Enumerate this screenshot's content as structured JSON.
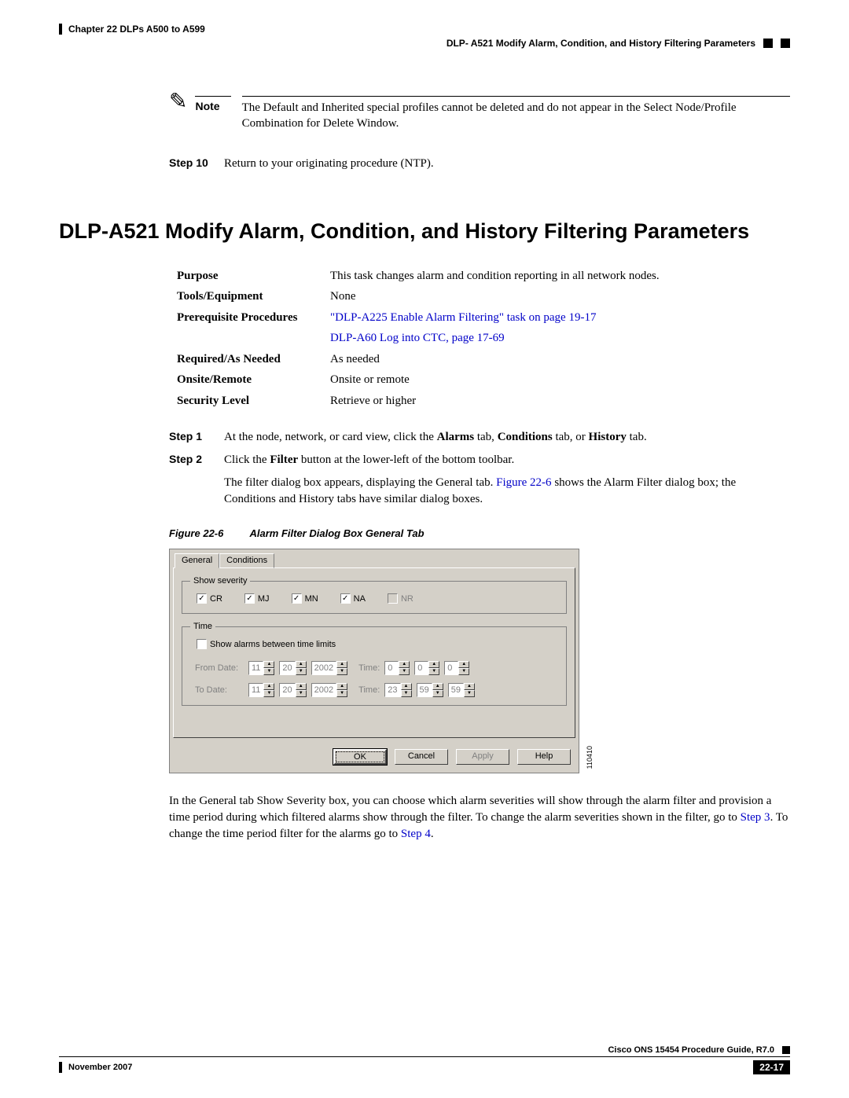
{
  "header": {
    "chapter": "Chapter 22      DLPs A500 to A599",
    "subtitle": "DLP- A521 Modify Alarm, Condition, and History Filtering Parameters"
  },
  "note": {
    "label": "Note",
    "text": "The Default and Inherited special profiles cannot be deleted and do not appear in the Select Node/Profile Combination for Delete Window."
  },
  "step10": {
    "label": "Step 10",
    "text": "Return to your originating procedure (NTP)."
  },
  "section_title": "DLP-A521 Modify Alarm, Condition, and History Filtering Parameters",
  "info": {
    "purpose_label": "Purpose",
    "purpose_value": "This task changes alarm and condition reporting in all network nodes.",
    "tools_label": "Tools/Equipment",
    "tools_value": "None",
    "prereq_label": "Prerequisite Procedures",
    "prereq_link1": "\"DLP-A225 Enable Alarm Filtering\" task on page 19-17",
    "prereq_link2": "DLP-A60 Log into CTC, page 17-69",
    "required_label": "Required/As Needed",
    "required_value": "As needed",
    "onsite_label": "Onsite/Remote",
    "onsite_value": "Onsite or remote",
    "security_label": "Security Level",
    "security_value": "Retrieve or higher"
  },
  "steps": {
    "s1_label": "Step 1",
    "s1_text_pre": "At the node, network, or card view, click the ",
    "s1_b1": "Alarms",
    "s1_mid1": " tab, ",
    "s1_b2": "Conditions",
    "s1_mid2": " tab, or ",
    "s1_b3": "History",
    "s1_post": " tab.",
    "s2_label": "Step 2",
    "s2_text_pre": "Click the ",
    "s2_b1": "Filter",
    "s2_post": " button at the lower-left of the bottom toolbar.",
    "s2_body_pre": "The filter dialog box appears, displaying the General tab. ",
    "s2_body_link": "Figure 22-6",
    "s2_body_post": " shows the Alarm Filter dialog box; the Conditions and History tabs have similar dialog boxes."
  },
  "figure": {
    "num": "Figure 22-6",
    "title": "Alarm Filter Dialog Box General Tab",
    "id": "110410"
  },
  "dialog": {
    "tabs": {
      "general": "General",
      "conditions": "Conditions"
    },
    "severity_legend": "Show severity",
    "sev": {
      "cr": "CR",
      "mj": "MJ",
      "mn": "MN",
      "na": "NA",
      "nr": "NR"
    },
    "time_legend": "Time",
    "time_cb": "Show alarms between time limits",
    "from_label": "From Date:",
    "to_label": "To Date:",
    "time_label": "Time:",
    "from": {
      "m": "11",
      "d": "20",
      "y": "2002",
      "h": "0",
      "mi": "0",
      "s": "0"
    },
    "to": {
      "m": "11",
      "d": "20",
      "y": "2002",
      "h": "23",
      "mi": "59",
      "s": "59"
    },
    "buttons": {
      "ok": "OK",
      "cancel": "Cancel",
      "apply": "Apply",
      "help": "Help"
    }
  },
  "body_after": {
    "pre": "In the General tab Show Severity box, you can choose which alarm severities will show through the alarm filter and provision a time period during which filtered alarms show through the filter. To change the alarm severities shown in the filter, go to ",
    "link1": "Step 3",
    "mid": ". To change the time period filter for the alarms go to ",
    "link2": "Step 4",
    "post": "."
  },
  "footer": {
    "book": "Cisco ONS 15454 Procedure Guide, R7.0",
    "date": "November 2007",
    "page": "22-17"
  }
}
